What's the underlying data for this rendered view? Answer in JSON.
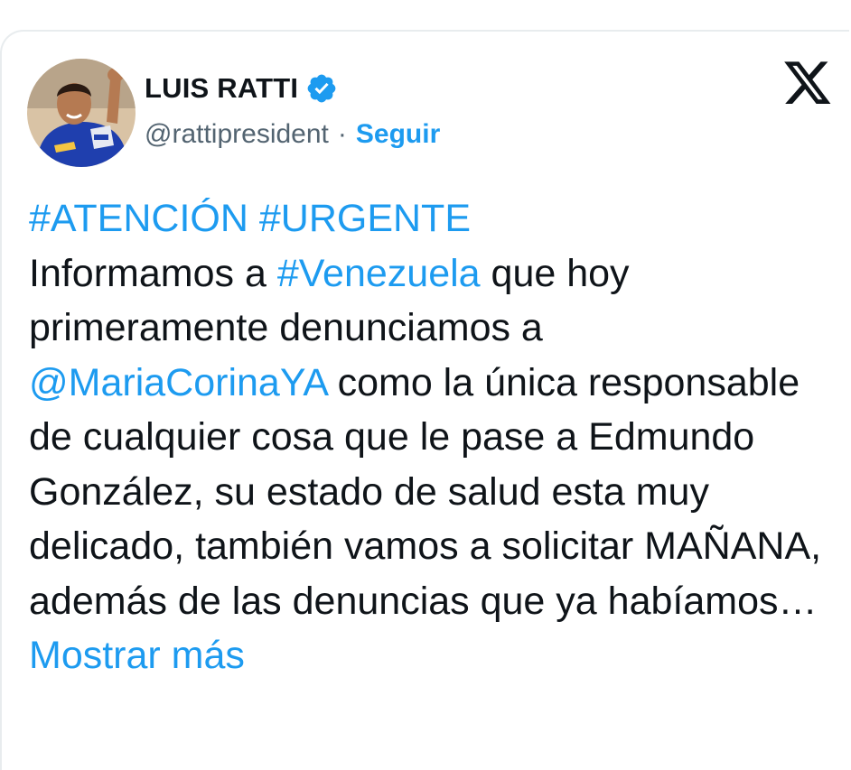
{
  "author": {
    "name": "LUIS RATTI",
    "handle": "@rattipresident",
    "separator": "·",
    "follow_label": "Seguir"
  },
  "icons": {
    "verified": "verified-badge-icon",
    "platform": "x-logo-icon"
  },
  "colors": {
    "link": "#1d9bf0",
    "text": "#0f1419",
    "secondary": "#536471"
  },
  "tweet": {
    "hashtag_atencion": "#ATENCIÓN",
    "hashtag_urgente": "#URGENTE",
    "text_informamos": "Informamos a ",
    "hashtag_venezuela": "#Venezuela",
    "text_que_hoy": " que hoy primeramente denunciamos a ",
    "mention": "@MariaCorinaYA",
    "text_body": " como la única responsable de cualquier cosa que le pase a Edmundo González, su estado de salud esta muy delicado, también vamos a solicitar MAÑANA, además de las denuncias que ya habíamos…",
    "show_more": "Mostrar más"
  }
}
